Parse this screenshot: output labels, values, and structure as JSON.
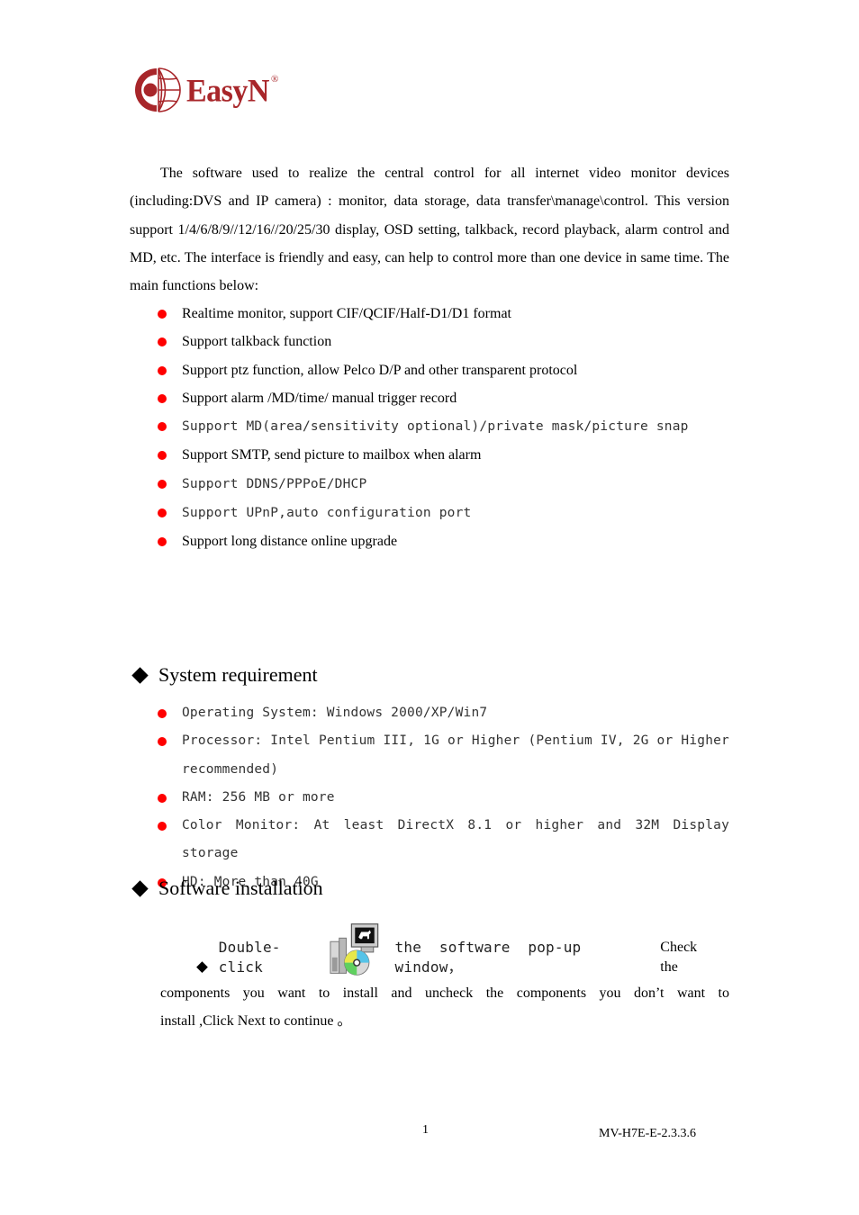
{
  "header": {
    "logo_text": "EasyN",
    "logo_registered": "®",
    "logo_icon": "globe-logo-icon",
    "brand_color": "#a8262a"
  },
  "intro": {
    "paragraph": "The software used to realize the central control for all internet video monitor devices (including:DVS and IP camera) : monitor, data storage, data transfer\\manage\\control. This version support 1/4/6/8/9//12/16//20/25/30 display, OSD setting, talkback, record playback, alarm control and MD, etc. The interface is friendly and easy, can help to control more than one device in same time. The main functions below:"
  },
  "features": {
    "bullet_icon": "red-dot-bullet-icon",
    "bullet_color": "#ff0000",
    "items": [
      {
        "text": "Realtime monitor, support CIF/QCIF/Half-D1/D1 format",
        "style": "serif"
      },
      {
        "text": "Support talkback function",
        "style": "serif"
      },
      {
        "text": "Support ptz function, allow Pelco D/P and other transparent protocol",
        "style": "serif"
      },
      {
        "text": "Support alarm /MD/time/ manual trigger record",
        "style": "serif"
      },
      {
        "text": "Support MD(area/sensitivity optional)/private mask/picture snap",
        "style": "mono"
      },
      {
        "text": "Support SMTP, send picture to mailbox when alarm",
        "style": "serif"
      },
      {
        "text": "Support DDNS/PPPoE/DHCP",
        "style": "mono"
      },
      {
        "text": "Support UPnP,auto configuration port",
        "style": "mono"
      },
      {
        "text": "Support long distance online upgrade",
        "style": "serif"
      }
    ]
  },
  "system_requirement": {
    "heading": "System requirement",
    "heading_icon": "diamond-bullet-icon",
    "items": [
      {
        "text": "Operating System: Windows 2000/XP/Win7"
      },
      {
        "text": "Processor: Intel Pentium III, 1G or Higher (Pentium IV, 2G or Higher recommended)"
      },
      {
        "text": "RAM: 256 MB or more"
      },
      {
        "text": "Color Monitor: At least DirectX 8.1 or higher and 32M Display storage"
      },
      {
        "text": "HD: More than 40G"
      }
    ]
  },
  "software_installation": {
    "heading": "Software installation",
    "heading_icon": "diamond-bullet-icon",
    "step_lead": "Double-click",
    "step_icon": "installer-setup-icon",
    "step_mid": "the software pop-up window，",
    "step_check": "Check the",
    "step_line2": "components you want to install and uncheck the components you don’t  want to",
    "step_line3": "install ,Click Next to continue 。"
  },
  "footer": {
    "page_number": "1",
    "doc_version": "MV-H7E-E-2.3.3.6"
  }
}
